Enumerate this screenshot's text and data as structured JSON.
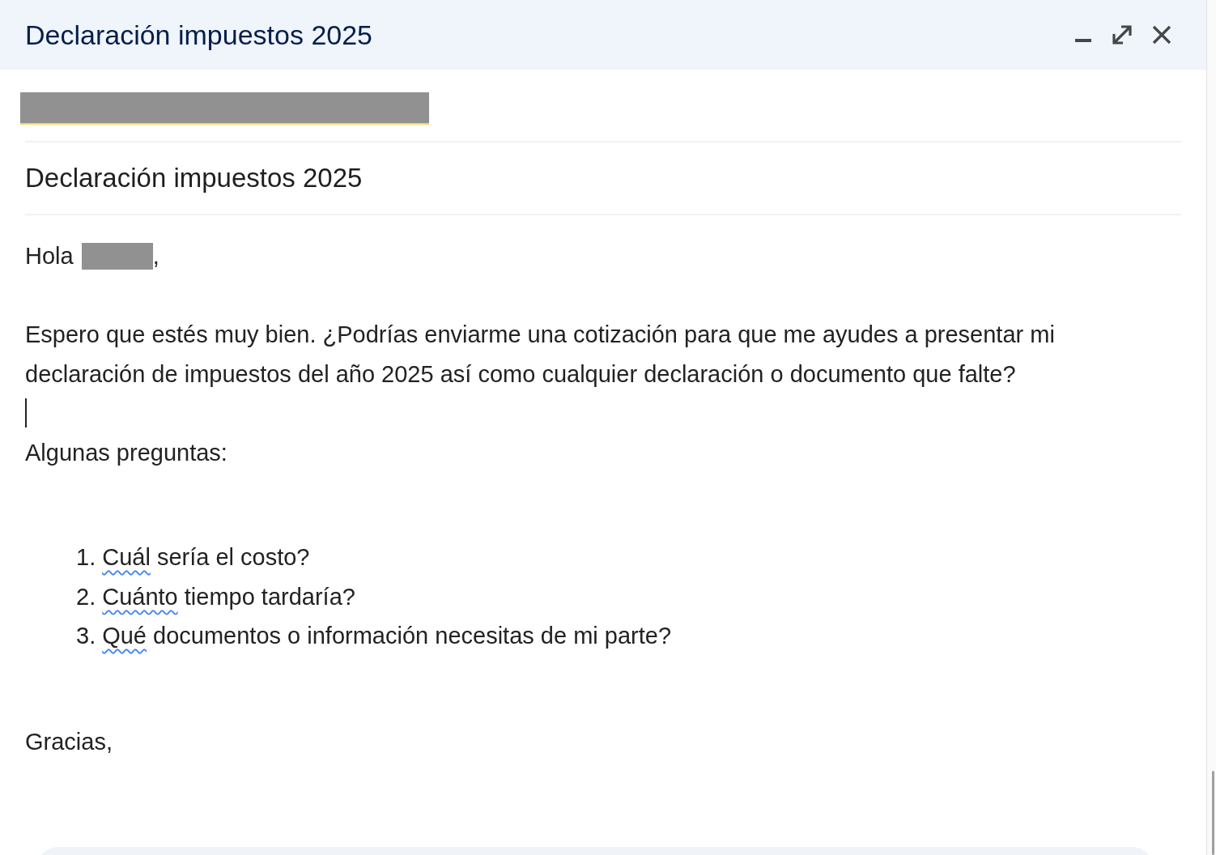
{
  "window": {
    "title": "Declaración impuestos 2025"
  },
  "recipient": {
    "redacted": true
  },
  "subject": "Declaración impuestos 2025",
  "body": {
    "greeting": {
      "before": "Hola",
      "after": ","
    },
    "paragraph": "Espero que estés muy bien. ¿Podrías enviarme una cotización para que me ayudes a presentar mi declaración de impuestos del año 2025 así como cualquier declaración o documento que falte?",
    "questions_intro": "Algunas preguntas:",
    "questions": [
      {
        "number": "1.",
        "flagged": "Cuál",
        "rest": " sería el costo?"
      },
      {
        "number": "2.",
        "flagged": "Cuánto",
        "rest": " tiempo tardaría?"
      },
      {
        "number": "3.",
        "flagged": "Qué",
        "rest": " documentos o información necesitas de mi parte?"
      }
    ],
    "closing": "Gracias,"
  }
}
